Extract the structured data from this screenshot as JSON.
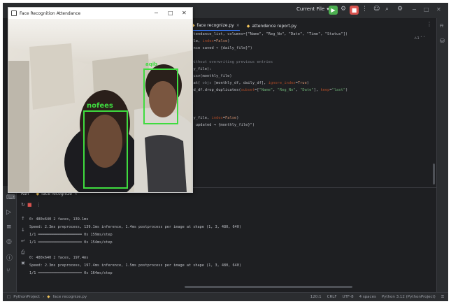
{
  "ide": {
    "run_config_label": "Current File",
    "editor_tabs": [
      {
        "label": "face recognize.py",
        "active": true
      },
      {
        "label": "attendence report.py",
        "active": false
      }
    ],
    "warning_indicator": "⚠1 ˄ ˅",
    "code_lines": [
      {
        "segments": [
          {
            "t": "attendance_list, columns=[\"Name\", \"Reg_No\", \"Date\", \"Time\", \"Status\"])",
            "c": ""
          }
        ]
      },
      {
        "segments": [
          {
            "t": "file, ",
            "c": ""
          },
          {
            "t": "index",
            "c": "kwarg"
          },
          {
            "t": "=",
            "c": ""
          },
          {
            "t": "False",
            "c": "kw"
          },
          {
            "t": ")",
            "c": ""
          }
        ]
      },
      {
        "segments": [
          {
            "t": "dance saved → {daily_file}\")",
            "c": ""
          }
        ]
      },
      {
        "segments": [
          {
            "t": "",
            "c": ""
          }
        ]
      },
      {
        "segments": [
          {
            "t": " without overwriting previous entries",
            "c": "cm"
          }
        ]
      },
      {
        "segments": [
          {
            "t": "ily_file):",
            "c": ""
          }
        ]
      },
      {
        "segments": [
          {
            "t": "d_csv(monthly_file)",
            "c": ""
          }
        ]
      },
      {
        "segments": [
          {
            "t": "ncat( ",
            "c": ""
          },
          {
            "t": "objs",
            "c": "cm"
          },
          {
            "t": " [monthly_df, daily_df], ",
            "c": ""
          },
          {
            "t": "ignore_index",
            "c": "kwarg"
          },
          {
            "t": "=",
            "c": ""
          },
          {
            "t": "True",
            "c": "kw"
          },
          {
            "t": ")",
            "c": ""
          }
        ]
      },
      {
        "segments": [
          {
            "t": "ned_df.drop_duplicates(",
            "c": ""
          },
          {
            "t": "subset",
            "c": "kwarg"
          },
          {
            "t": "=[",
            "c": ""
          },
          {
            "t": "\"Name\"",
            "c": "str"
          },
          {
            "t": ", ",
            "c": ""
          },
          {
            "t": "\"Reg_No\"",
            "c": "str"
          },
          {
            "t": ", ",
            "c": ""
          },
          {
            "t": "\"Date\"",
            "c": "str"
          },
          {
            "t": "], ",
            "c": ""
          },
          {
            "t": "keep",
            "c": "kwarg"
          },
          {
            "t": "=",
            "c": ""
          },
          {
            "t": "\"last\"",
            "c": "str"
          },
          {
            "t": ")",
            "c": ""
          }
        ]
      },
      {
        "segments": [
          {
            "t": "",
            "c": ""
          }
        ]
      },
      {
        "segments": [
          {
            "t": "df",
            "c": ""
          }
        ]
      },
      {
        "segments": [
          {
            "t": "",
            "c": ""
          }
        ]
      },
      {
        "segments": [
          {
            "t": "hly_file, ",
            "c": ""
          },
          {
            "t": "index",
            "c": "kwarg"
          },
          {
            "t": "=",
            "c": ""
          },
          {
            "t": "False",
            "c": "kw"
          },
          {
            "t": ")",
            "c": ""
          }
        ]
      },
      {
        "segments": [
          {
            "t": "rt updated → {monthly_file}\")",
            "c": ""
          }
        ]
      }
    ],
    "run_panel": {
      "run_label": "Run",
      "tab_label": "face recognize",
      "output_lines": [
        "0: 480x640 2 faces, 139.1ms",
        "Speed: 2.3ms preprocess, 139.1ms inference, 1.4ms postprocess per image at shape (1, 3, 480, 640)",
        "1/1 ━━━━━━━━━━━━━━━━━━━━ 0s 159ms/step",
        "1/1 ━━━━━━━━━━━━━━━━━━━━ 0s 154ms/step",
        "",
        "0: 480x640 2 faces, 197.4ms",
        "Speed: 2.3ms preprocess, 197.4ms inference, 1.5ms postprocess per image at shape (1, 3, 480, 640)",
        "1/1 ━━━━━━━━━━━━━━━━━━━━ 0s 164ms/step"
      ]
    },
    "status_bar": {
      "project": "PythonProject",
      "file": "face recognize.py",
      "position": "120:1",
      "line_ending": "CRLF",
      "encoding": "UTF-8",
      "indent": "4 spaces",
      "interpreter": "Python 3.12 (PythonProject)"
    }
  },
  "camera_window": {
    "title": "Face Recognition Attendance",
    "detections": [
      {
        "label": "nofees"
      },
      {
        "label": "aqib"
      }
    ]
  },
  "colors": {
    "ide_bg": "#1e1f22",
    "panel_bg": "#2b2d30",
    "detection_box": "#3fdc3f",
    "run_button": "#4caf50",
    "stop_button": "#d9534f"
  }
}
